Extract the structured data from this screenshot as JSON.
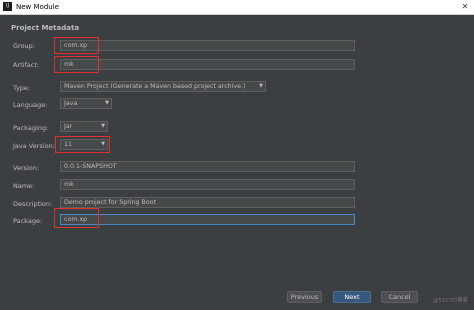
{
  "window": {
    "title": "New Module",
    "app_icon": "intellij-icon"
  },
  "section_title": "Project Metadata",
  "fields": {
    "group": {
      "label": "Group:",
      "value": "com.xp"
    },
    "artifact": {
      "label": "Artifact:",
      "value": "mk"
    },
    "type": {
      "label": "Type:",
      "value": "Maven Project (Generate a Maven based project archive.)"
    },
    "language": {
      "label": "Language:",
      "value": "Java"
    },
    "packaging": {
      "label": "Packaging:",
      "value": "Jar"
    },
    "java_version": {
      "label": "Java Version:",
      "value": "11"
    },
    "version": {
      "label": "Version:",
      "value": "0.0.1-SNAPSHOT"
    },
    "name": {
      "label": "Name:",
      "value": "mk"
    },
    "description": {
      "label": "Description:",
      "value": "Demo project for Spring Boot"
    },
    "package": {
      "label": "Package:",
      "value": "com.xp"
    }
  },
  "buttons": {
    "previous": "Previous",
    "next": "Next",
    "cancel": "Cancel",
    "help": "Help"
  },
  "watermark": "@51CTO博客",
  "colors": {
    "highlight": "#e03030",
    "primary_button": "#365880",
    "focus_border": "#4a88c7"
  }
}
